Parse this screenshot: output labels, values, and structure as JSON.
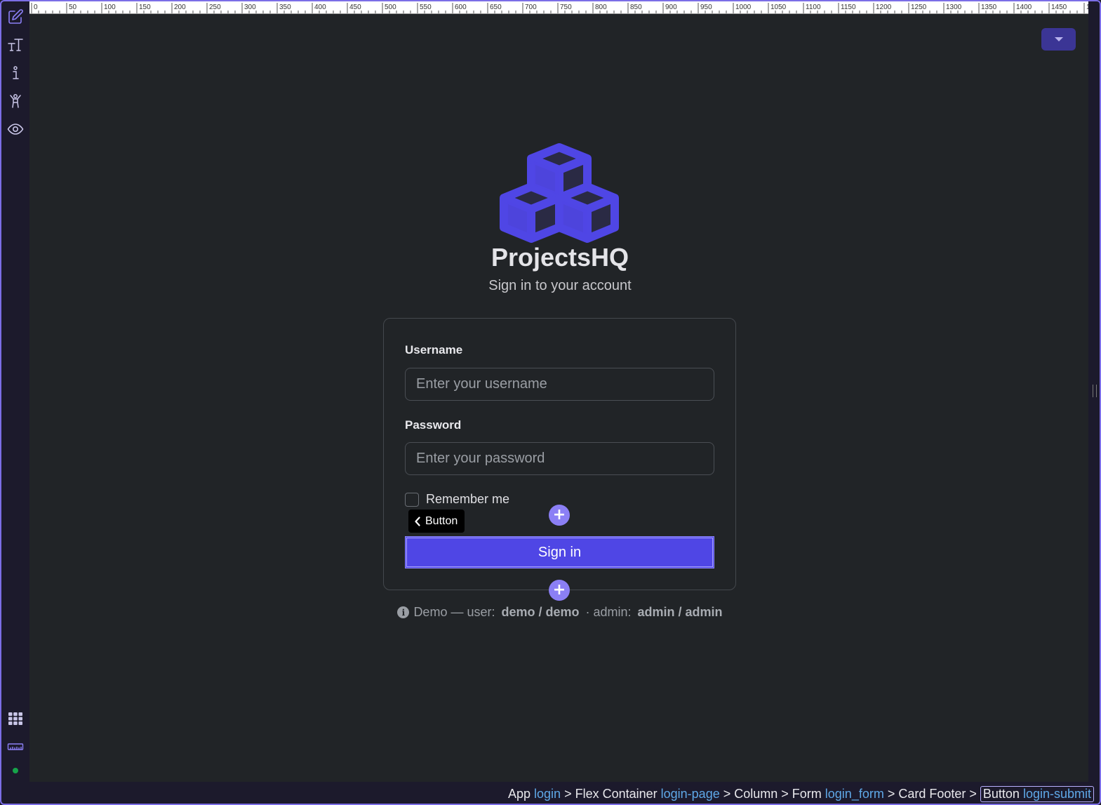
{
  "toolbar": {
    "items": [
      {
        "name": "edit",
        "icon": "pencil-square-icon"
      },
      {
        "name": "text",
        "icon": "text-size-icon"
      },
      {
        "name": "info",
        "icon": "info-icon"
      },
      {
        "name": "accessibility",
        "icon": "figure-icon"
      },
      {
        "name": "preview",
        "icon": "eye-icon"
      }
    ],
    "bottom": [
      {
        "name": "grid",
        "icon": "grid-icon"
      },
      {
        "name": "ruler",
        "icon": "ruler-icon"
      }
    ]
  },
  "ruler": {
    "labels": [
      "0",
      "50",
      "100",
      "150",
      "200",
      "250",
      "300",
      "350",
      "400",
      "450",
      "500",
      "550",
      "600",
      "650",
      "700",
      "750",
      "800",
      "850",
      "900",
      "950",
      "1000",
      "1050",
      "1100",
      "1150",
      "1200",
      "1250",
      "1300",
      "1350",
      "1400",
      "1450",
      "15"
    ]
  },
  "brand": {
    "name": "ProjectsHQ",
    "subtitle": "Sign in to your account",
    "color": "#4f46e5"
  },
  "form": {
    "username_label": "Username",
    "username_placeholder": "Enter your username",
    "password_label": "Password",
    "password_placeholder": "Enter your password",
    "remember_label": "Remember me",
    "submit_label": "Sign in"
  },
  "editor": {
    "element_tag": "Button",
    "add_symbol": "+"
  },
  "demo": {
    "prefix": "Demo — user: ",
    "user_creds": "demo / demo",
    "middle": " · admin: ",
    "admin_creds": "admin / admin"
  },
  "breadcrumb": [
    {
      "type": "App",
      "id": "login"
    },
    {
      "type": "Flex Container",
      "id": "login-page"
    },
    {
      "type": "Column",
      "id": ""
    },
    {
      "type": "Form",
      "id": "login_form"
    },
    {
      "type": "Card Footer",
      "id": ""
    },
    {
      "type": "Button",
      "id": "login-submit",
      "current": true
    }
  ]
}
